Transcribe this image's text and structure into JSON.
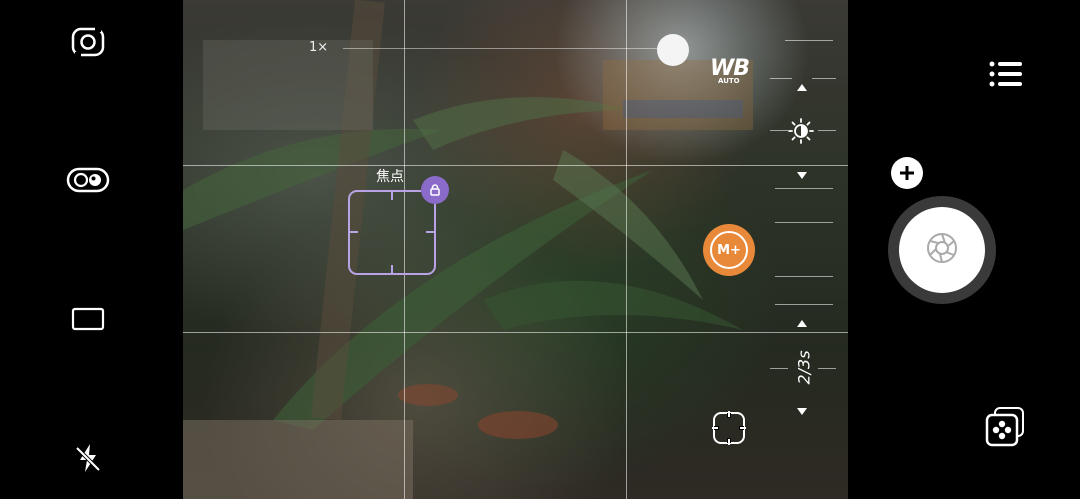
{
  "zoom": {
    "label": "1×",
    "level": 0.95
  },
  "focus": {
    "label": "焦点"
  },
  "white_balance": {
    "label": "WB",
    "mode": "AUTO"
  },
  "exposure": {
    "shutter_speed": "2/3s"
  },
  "mode_badge": {
    "label": "M+"
  },
  "icons": {
    "switch_camera": "switch-camera-icon",
    "portrait_mode": "dual-lens-icon",
    "aspect_ratio": "aspect-ratio-icon",
    "flash": "flash-off-icon",
    "menu": "menu-icon",
    "gallery": "gallery-icon",
    "add": "plus-icon",
    "shutter": "aperture-icon",
    "focus_frame": "focus-frame-icon",
    "brightness": "brightness-icon",
    "lock": "lock-icon"
  },
  "colors": {
    "focus_accent": "#b9a3e6",
    "lock_badge": "#8a6bc9",
    "mode_badge": "#e8893a"
  }
}
